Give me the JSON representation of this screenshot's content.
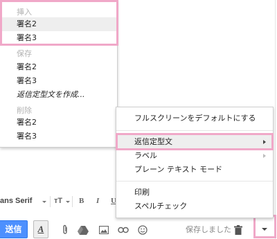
{
  "template_menu": {
    "insert_header": "挿入",
    "insert_items": [
      "署名2",
      "署名3"
    ],
    "save_header": "保存",
    "save_items": [
      "署名2",
      "署名3"
    ],
    "create_item": "返信定型文を作成...",
    "delete_header": "削除",
    "delete_items": [
      "署名2",
      "署名3"
    ]
  },
  "more_menu": {
    "fullscreen_default": "フルスクリーンをデフォルトにする",
    "canned_responses": "返信定型文",
    "label": "ラベル",
    "plain_text": "プレーン テキスト モード",
    "print": "印刷",
    "spell_check": "スペルチェック"
  },
  "format_bar": {
    "font": "ans Serif",
    "size_glyph": "ᴛT",
    "bold": "B",
    "italic": "I",
    "underline": "U"
  },
  "action_bar": {
    "send": "送信",
    "format_toggle": "A",
    "saved_status": "保存しました"
  },
  "colors": {
    "send_blue": "#4d90fe",
    "highlight_pink": "#f0a8c8",
    "hover_gray": "#eeeeee"
  }
}
